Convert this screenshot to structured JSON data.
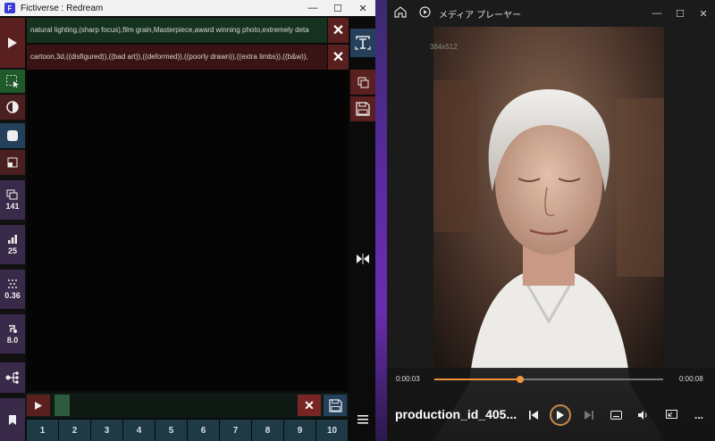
{
  "left_window": {
    "title": "Fictiverse : Redream",
    "app_icon_letter": "F",
    "positive_prompt": "natural lighting,(sharp focus),film grain,Masterpiece,award winning photo,extremely deta",
    "negative_prompt": "cartoon,3d,((disfigured)),((bad art)),((deformed)),((poorly drawn)),((extra limbs)),((b&w)),",
    "sidebar_values": {
      "steps": "141",
      "cfg": "25",
      "denoise": "0.36",
      "strength": "8.0"
    },
    "number_buttons": [
      "1",
      "2",
      "3",
      "4",
      "5",
      "6",
      "7",
      "8",
      "9",
      "10"
    ],
    "colors": {
      "prompt_bg": "#14321f",
      "negative_bg": "#3a1414",
      "accent_red": "#7a2525",
      "accent_green": "#2e7a3a",
      "accent_blue": "#2e4a6a",
      "accent_purple": "#4a2a4a"
    }
  },
  "media_player": {
    "title": "メディア プレーヤー",
    "overlay_dimensions": "384x512",
    "time_elapsed": "0:00:03",
    "time_total": "0:00:08",
    "progress": 0.375,
    "filename": "production_id_405...",
    "more_label": "..."
  }
}
